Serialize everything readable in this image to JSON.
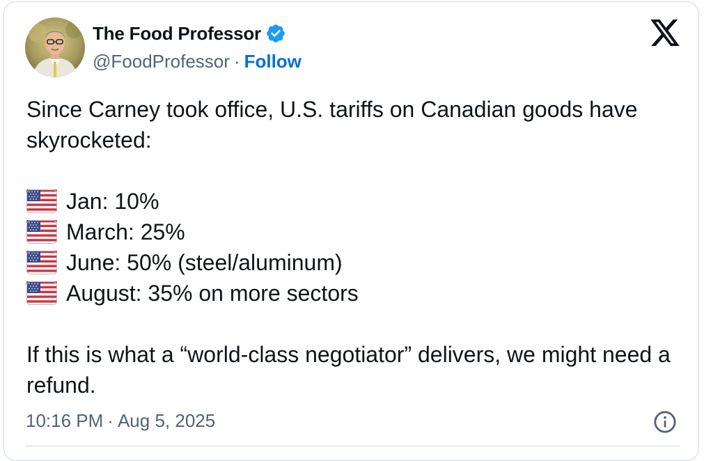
{
  "author": {
    "display_name": "The Food Professor",
    "handle": "@FoodProfessor",
    "separator": "·",
    "follow_label": "Follow",
    "verified_icon": "verified-badge-icon",
    "brand_color": "#1d9bf0"
  },
  "platform": {
    "logo_icon": "x-logo-icon"
  },
  "tweet": {
    "intro": "Since Carney took office, U.S. tariffs on Canadian goods have skyrocketed:",
    "items": [
      {
        "icon": "us-flag-icon",
        "text": "Jan: 10%"
      },
      {
        "icon": "us-flag-icon",
        "text": "March: 25%"
      },
      {
        "icon": "us-flag-icon",
        "text": "June: 50% (steel/aluminum)"
      },
      {
        "icon": "us-flag-icon",
        "text": "August: 35% on more sectors"
      }
    ],
    "closing": "If this is what a “world-class negotiator” delivers, we might need a refund."
  },
  "meta": {
    "time": "10:16 PM",
    "separator": "·",
    "date": "Aug 5, 2025",
    "info_icon": "info-icon"
  }
}
